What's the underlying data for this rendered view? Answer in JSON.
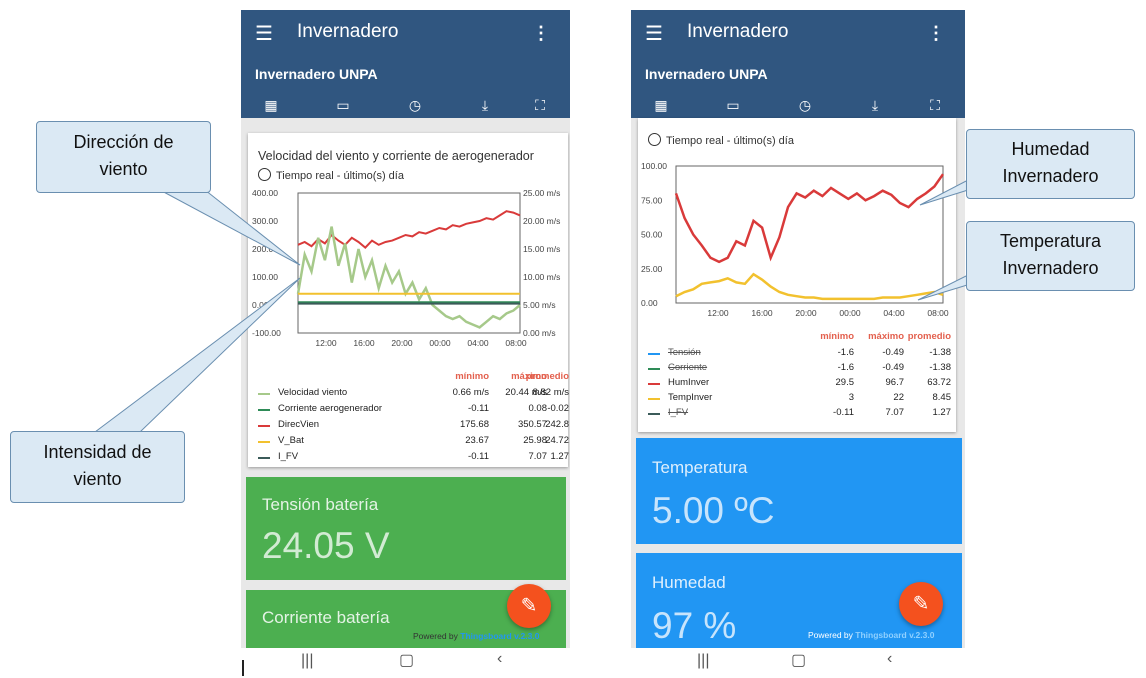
{
  "colors": {
    "header": "#305680",
    "wind_speed": "#a6c98a",
    "current": "#2e8b57",
    "direction": "#d93a3a",
    "battery_v": "#f2c12e",
    "i_fv": "#3b5b59",
    "green_tile": "#4caf50",
    "blue_tile": "#2196f3",
    "fab": "#f4511e"
  },
  "phone_left": {
    "app_title": "Invernadero",
    "dashboard_title": "Invernadero UNPA",
    "toolbar_icons": [
      "dashboard-icon",
      "display-icon",
      "history-icon",
      "download-icon",
      "fullscreen-icon"
    ],
    "card_title": "Velocidad del viento y corriente de aerogenerador",
    "time_label": "Tiempo real - último(s) día",
    "legend_headers": [
      "mínimo",
      "máximo",
      "promedio"
    ],
    "legend": [
      {
        "name": "Velocidad viento",
        "min": "0.66 m/s",
        "max": "20.44 m/s",
        "avg": "8.82 m/s"
      },
      {
        "name": "Corriente aerogenerador",
        "min": "-0.11",
        "max": "0.08",
        "avg": "-0.02"
      },
      {
        "name": "DirecVien",
        "min": "175.68",
        "max": "350.57",
        "avg": "242.8"
      },
      {
        "name": "V_Bat",
        "min": "23.67",
        "max": "25.98",
        "avg": "24.72"
      },
      {
        "name": "I_FV",
        "min": "-0.11",
        "max": "7.07",
        "avg": "1.27"
      }
    ],
    "tile1_label": "Tensión batería",
    "tile1_value": "24.05 V",
    "tile2_label": "Corriente batería",
    "powered_prefix": "Powered by",
    "powered_link": "Thingsboard v.2.3.0"
  },
  "phone_right": {
    "app_title": "Invernadero",
    "dashboard_title": "Invernadero UNPA",
    "time_label": "Tiempo real - último(s) día",
    "legend_headers": [
      "mínimo",
      "máximo",
      "promedio"
    ],
    "legend": [
      {
        "name": "Tensión",
        "min": "-1.6",
        "max": "-0.49",
        "avg": "-1.38",
        "hidden": true
      },
      {
        "name": "Corriente",
        "min": "-1.6",
        "max": "-0.49",
        "avg": "-1.38",
        "hidden": true
      },
      {
        "name": "HumInver",
        "min": "29.5",
        "max": "96.7",
        "avg": "63.72",
        "hidden": false
      },
      {
        "name": "TempInver",
        "min": "3",
        "max": "22",
        "avg": "8.45",
        "hidden": false
      },
      {
        "name": "I_FV",
        "min": "-0.11",
        "max": "7.07",
        "avg": "1.27",
        "hidden": true
      }
    ],
    "tile1_label": "Temperatura",
    "tile1_value": "5.00 ºC",
    "tile2_label": "Humedad",
    "tile2_value": "97 %",
    "powered_prefix": "Powered by",
    "powered_link": "Thingsboard v.2.3.0"
  },
  "callouts": {
    "direccion": [
      "Dirección de",
      "viento"
    ],
    "intensidad": [
      "Intensidad de",
      "viento"
    ],
    "humedad": [
      "Humedad",
      "Invernadero"
    ],
    "temperatura": [
      "Temperatura",
      "Invernadero"
    ]
  },
  "chart_data": [
    {
      "type": "line",
      "title": "Velocidad del viento y corriente de aerogenerador",
      "x_ticks": [
        "12:00",
        "16:00",
        "20:00",
        "00:00",
        "04:00",
        "08:00"
      ],
      "y_left_ticks": [
        "400.00",
        "300.00",
        "200.00",
        "100.00",
        "0.00",
        "-100.00"
      ],
      "y_right_ticks": [
        "25.00 m/s",
        "20.00 m/s",
        "15.00 m/s",
        "10.00 m/s",
        "5.00 m/s",
        "0.00 m/s"
      ],
      "ylim_left": [
        -100,
        400
      ],
      "ylim_right": [
        0,
        25
      ],
      "series": [
        {
          "name": "DirecVien",
          "axis": "left",
          "values": [
            215,
            225,
            210,
            235,
            220,
            250,
            230,
            215,
            240,
            225,
            205,
            230,
            215,
            225,
            230,
            240,
            250,
            245,
            260,
            255,
            265,
            275,
            270,
            285,
            280,
            290,
            295,
            300,
            310,
            305,
            320,
            335,
            330,
            320
          ]
        },
        {
          "name": "Velocidad viento",
          "axis": "right",
          "values": [
            7,
            14,
            11,
            17,
            13,
            19,
            12,
            16,
            9,
            15,
            10,
            13,
            8,
            12,
            9,
            11,
            7,
            9,
            6,
            8,
            5,
            4,
            3,
            2.5,
            3,
            2,
            1.5,
            1,
            2,
            3,
            2.5,
            3.5,
            4,
            5
          ]
        },
        {
          "name": "V_Bat",
          "axis": "left",
          "values": [
            40,
            40,
            40,
            40,
            40,
            40,
            40,
            40,
            40,
            40,
            40,
            40,
            40,
            40,
            40,
            40,
            40,
            40,
            40,
            40,
            40,
            40,
            40,
            40,
            40,
            40,
            40,
            40,
            40,
            40,
            40,
            40,
            40,
            40
          ]
        },
        {
          "name": "Corriente aerogenerador",
          "axis": "left",
          "values": [
            10,
            10,
            10,
            10,
            10,
            10,
            10,
            10,
            10,
            10,
            10,
            10,
            10,
            10,
            10,
            10,
            10,
            10,
            10,
            10,
            10,
            10,
            10,
            10,
            10,
            10,
            10,
            10,
            10,
            10,
            10,
            10,
            10,
            10
          ]
        },
        {
          "name": "I_FV",
          "axis": "left",
          "values": [
            5,
            5,
            5,
            5,
            5,
            5,
            5,
            5,
            5,
            5,
            5,
            5,
            5,
            5,
            5,
            5,
            5,
            5,
            5,
            5,
            5,
            5,
            5,
            5,
            5,
            5,
            5,
            5,
            5,
            5,
            5,
            5,
            5,
            5
          ]
        }
      ]
    },
    {
      "type": "line",
      "x_ticks": [
        "12:00",
        "16:00",
        "20:00",
        "00:00",
        "04:00",
        "08:00"
      ],
      "y_ticks": [
        "100.00",
        "75.00",
        "50.00",
        "25.00",
        "0.00"
      ],
      "ylim": [
        0,
        100
      ],
      "series": [
        {
          "name": "HumInver",
          "values": [
            80,
            62,
            50,
            42,
            33,
            30,
            33,
            45,
            42,
            60,
            55,
            33,
            48,
            70,
            80,
            77,
            82,
            78,
            84,
            80,
            76,
            80,
            75,
            78,
            82,
            79,
            73,
            70,
            76,
            80,
            85,
            94
          ]
        },
        {
          "name": "TempInver",
          "values": [
            5,
            8,
            10,
            14,
            15,
            16,
            18,
            15,
            14,
            21,
            17,
            12,
            8,
            6,
            5,
            4,
            4,
            3,
            3,
            3,
            3,
            3,
            3,
            3,
            4,
            4,
            4,
            5,
            6,
            7,
            8,
            6
          ]
        }
      ]
    }
  ]
}
